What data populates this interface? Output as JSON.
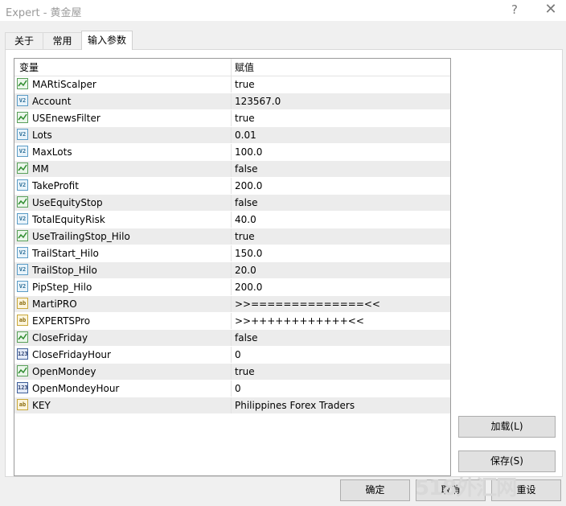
{
  "window": {
    "title": "Expert - 黄金屋",
    "help_glyph": "?",
    "close_glyph": "✕"
  },
  "tabs": [
    {
      "label": "关于"
    },
    {
      "label": "常用"
    },
    {
      "label": "输入参数",
      "active": true
    }
  ],
  "grid": {
    "columns": [
      "变量",
      "赋值"
    ],
    "rows": [
      {
        "type": "bool",
        "name": "MARtiScalper",
        "value": "true"
      },
      {
        "type": "double",
        "name": "Account",
        "value": "123567.0"
      },
      {
        "type": "bool",
        "name": "USEnewsFilter",
        "value": "true"
      },
      {
        "type": "double",
        "name": "Lots",
        "value": "0.01"
      },
      {
        "type": "double",
        "name": "MaxLots",
        "value": "100.0"
      },
      {
        "type": "bool",
        "name": "MM",
        "value": "false"
      },
      {
        "type": "double",
        "name": "TakeProfit",
        "value": "200.0"
      },
      {
        "type": "bool",
        "name": "UseEquityStop",
        "value": "false"
      },
      {
        "type": "double",
        "name": "TotalEquityRisk",
        "value": "40.0"
      },
      {
        "type": "bool",
        "name": "UseTrailingStop_Hilo",
        "value": "true"
      },
      {
        "type": "double",
        "name": "TrailStart_Hilo",
        "value": "150.0"
      },
      {
        "type": "double",
        "name": "TrailStop_Hilo",
        "value": "20.0"
      },
      {
        "type": "double",
        "name": "PipStep_Hilo",
        "value": "200.0"
      },
      {
        "type": "string",
        "name": "MartiPRO",
        "value": ">>==============<<"
      },
      {
        "type": "string",
        "name": "EXPERTSPro",
        "value": ">>++++++++++++<<"
      },
      {
        "type": "bool",
        "name": "CloseFriday",
        "value": "false"
      },
      {
        "type": "int",
        "name": "CloseFridayHour",
        "value": "0"
      },
      {
        "type": "bool",
        "name": "OpenMondey",
        "value": "true"
      },
      {
        "type": "int",
        "name": "OpenMondeyHour",
        "value": "0"
      },
      {
        "type": "string",
        "name": "KEY",
        "value": "Philippines Forex Traders"
      }
    ]
  },
  "icons": {
    "bool": "bool-param-icon",
    "double": "double-param-icon",
    "string": "string-param-icon",
    "int": "int-param-icon",
    "double_text": "V2",
    "string_text": "ab",
    "int_text": "123"
  },
  "buttons": {
    "load": "加载(L)",
    "save": "保存(S)",
    "ok": "确定",
    "cancel": "取消",
    "reset": "重设"
  },
  "watermark": "518外汇网"
}
